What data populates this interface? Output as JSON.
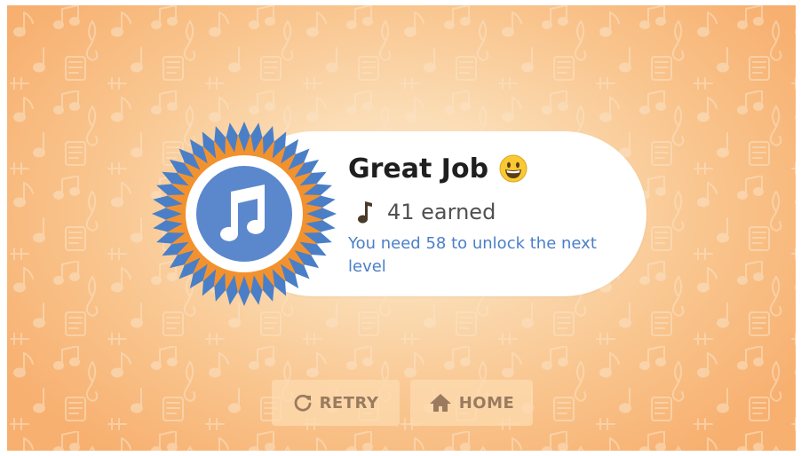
{
  "result": {
    "title": "Great Job",
    "earned": "41 earned",
    "unlock_message": "You need 58 to unlock the next level"
  },
  "icons": {
    "badge": "music-note-badge-icon",
    "emoji": "grinning-face-emoji-icon",
    "earned": "music-note-icon",
    "retry": "retry-icon",
    "home": "home-icon"
  },
  "buttons": {
    "retry_label": "RETRY",
    "home_label": "HOME"
  },
  "colors": {
    "accent_blue": "#4a7fc8",
    "badge_orange": "#f2922f",
    "button_text": "#9a7b60",
    "background": "#f9c58e"
  }
}
